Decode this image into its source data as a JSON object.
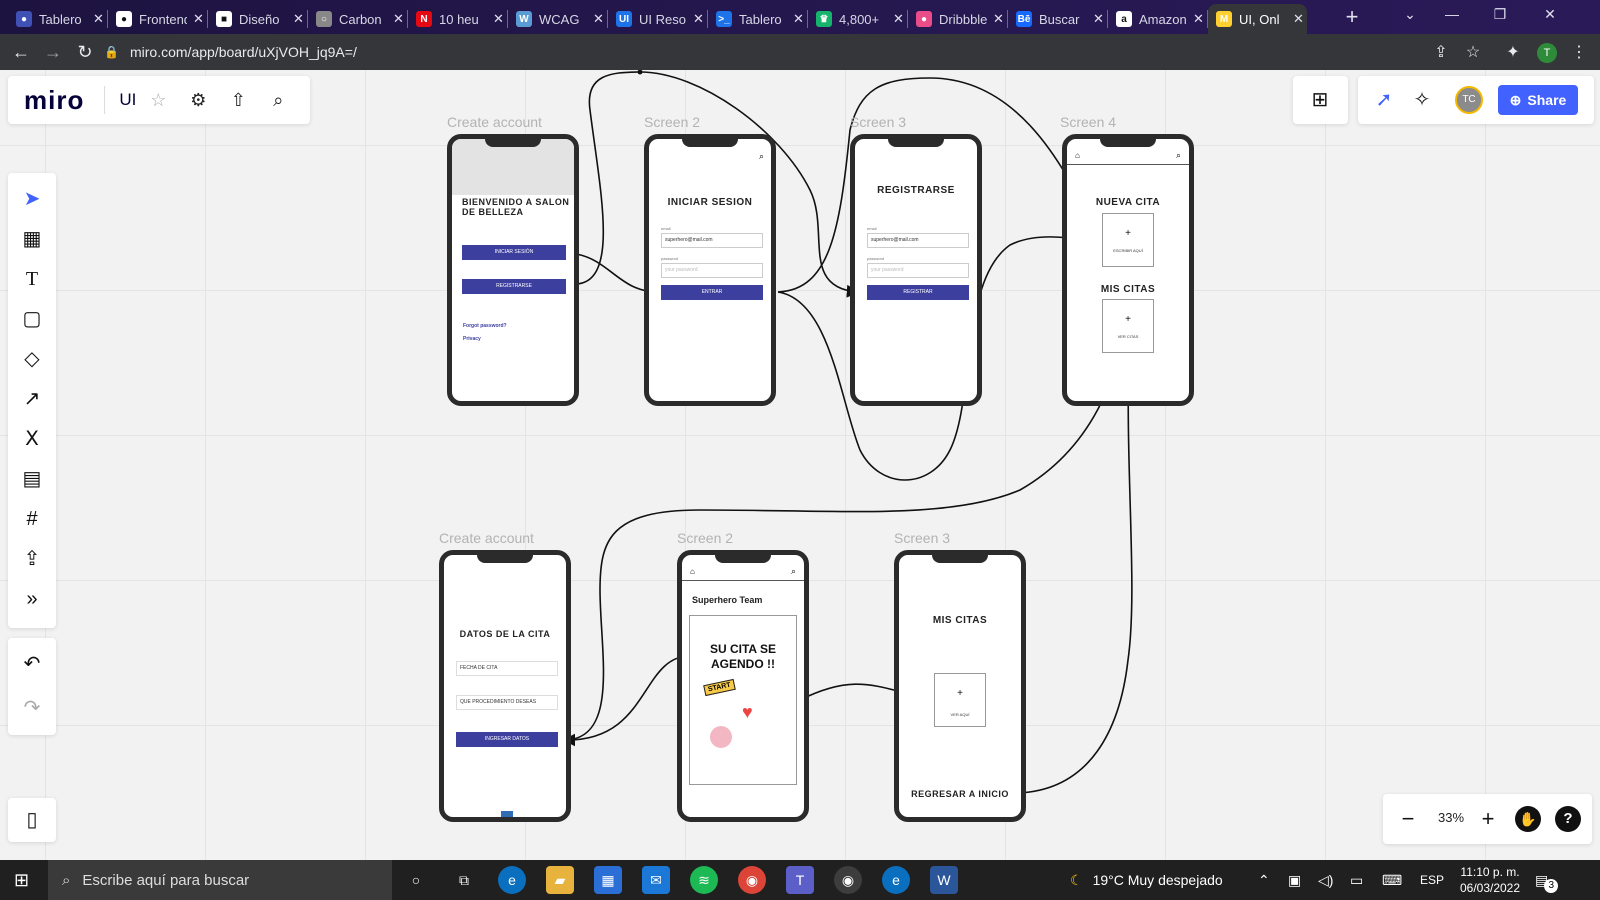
{
  "browser": {
    "tabs": [
      {
        "label": "Tablero",
        "icon_color": "#3f51b5",
        "icon_char": "●"
      },
      {
        "label": "Frontend",
        "icon_color": "#ffffff",
        "icon_char": "●"
      },
      {
        "label": "Diseño",
        "icon_color": "#ffffff",
        "icon_char": "■"
      },
      {
        "label": "Carbon",
        "icon_color": "#888888",
        "icon_char": "○"
      },
      {
        "label": "10 heu",
        "icon_color": "#e50914",
        "icon_char": "N"
      },
      {
        "label": "WCAG",
        "icon_color": "#5a9bd5",
        "icon_char": "W"
      },
      {
        "label": "UI Reso",
        "icon_color": "#1e73e8",
        "icon_char": "UI"
      },
      {
        "label": "Tablero",
        "icon_color": "#1e73e8",
        "icon_char": ">_"
      },
      {
        "label": "4,800+",
        "icon_color": "#15b36b",
        "icon_char": "♛"
      },
      {
        "label": "Dribbble",
        "icon_color": "#ea4c89",
        "icon_char": "●"
      },
      {
        "label": "Buscar",
        "icon_color": "#1769ff",
        "icon_char": "Bē"
      },
      {
        "label": "Amazon",
        "icon_color": "#ffffff",
        "icon_char": "a"
      },
      {
        "label": "UI, Onl",
        "icon_color": "#ffd02f",
        "icon_char": "M"
      }
    ],
    "active_tab": 12,
    "url": "miro.com/app/board/uXjVOH_jq9A=/",
    "profile_initial": "T"
  },
  "board": {
    "logo": "miro",
    "name": "UI",
    "share_label": "Share",
    "avatar_initials": "TC",
    "zoom": "33%",
    "help": "?"
  },
  "frames_top": [
    {
      "title": "Create account"
    },
    {
      "title": "Screen 2"
    },
    {
      "title": "Screen 3"
    },
    {
      "title": "Screen 4"
    }
  ],
  "frames_bottom": [
    {
      "title": "Create account"
    },
    {
      "title": "Screen 2"
    },
    {
      "title": "Screen 3"
    }
  ],
  "screens": {
    "welcome": {
      "title": "BIENVENIDO A SALON DE BELLEZA",
      "btn_login": "INICIAR SESIÓN",
      "btn_register": "REGISTRARSE",
      "link_forgot": "Forgot password?",
      "link_privacy": "Privacy"
    },
    "login": {
      "title": "INICIAR SESION",
      "email_label": "email",
      "email_value": "superhero@mail.com",
      "password_label": "password",
      "password_value": "your password",
      "btn": "ENTRAR"
    },
    "register": {
      "title": "REGISTRARSE",
      "email_label": "email",
      "email_value": "superhero@mail.com",
      "password_label": "password",
      "password_value": "your password",
      "btn": "REGISTRAR"
    },
    "home": {
      "title_new": "NUEVA CITA",
      "new_caption": "ESCRIBIR AQUÍ",
      "title_mine": "MIS CITAS",
      "mine_caption": "VER CITAS",
      "plus": "+"
    },
    "datos": {
      "title": "DATOS DE LA CITA",
      "field1": "FECHA DE CITA",
      "field2": "QUE PROCEDIMIENTO DESEAS",
      "btn": "INGRESAR DATOS"
    },
    "confirm": {
      "team": "Superhero Team",
      "title": "SU CITA SE AGENDO !!",
      "sticker": "START"
    },
    "mis": {
      "title": "MIS CITAS",
      "plus": "+",
      "caption": "VER AQUÍ",
      "footer": "REGRESAR A INICIO"
    }
  },
  "taskbar": {
    "search_placeholder": "Escribe aquí para buscar",
    "weather": "19°C  Muy despejado",
    "lang": "ESP",
    "time": "11:10 p. m.",
    "date": "06/03/2022",
    "notif_count": "3"
  }
}
